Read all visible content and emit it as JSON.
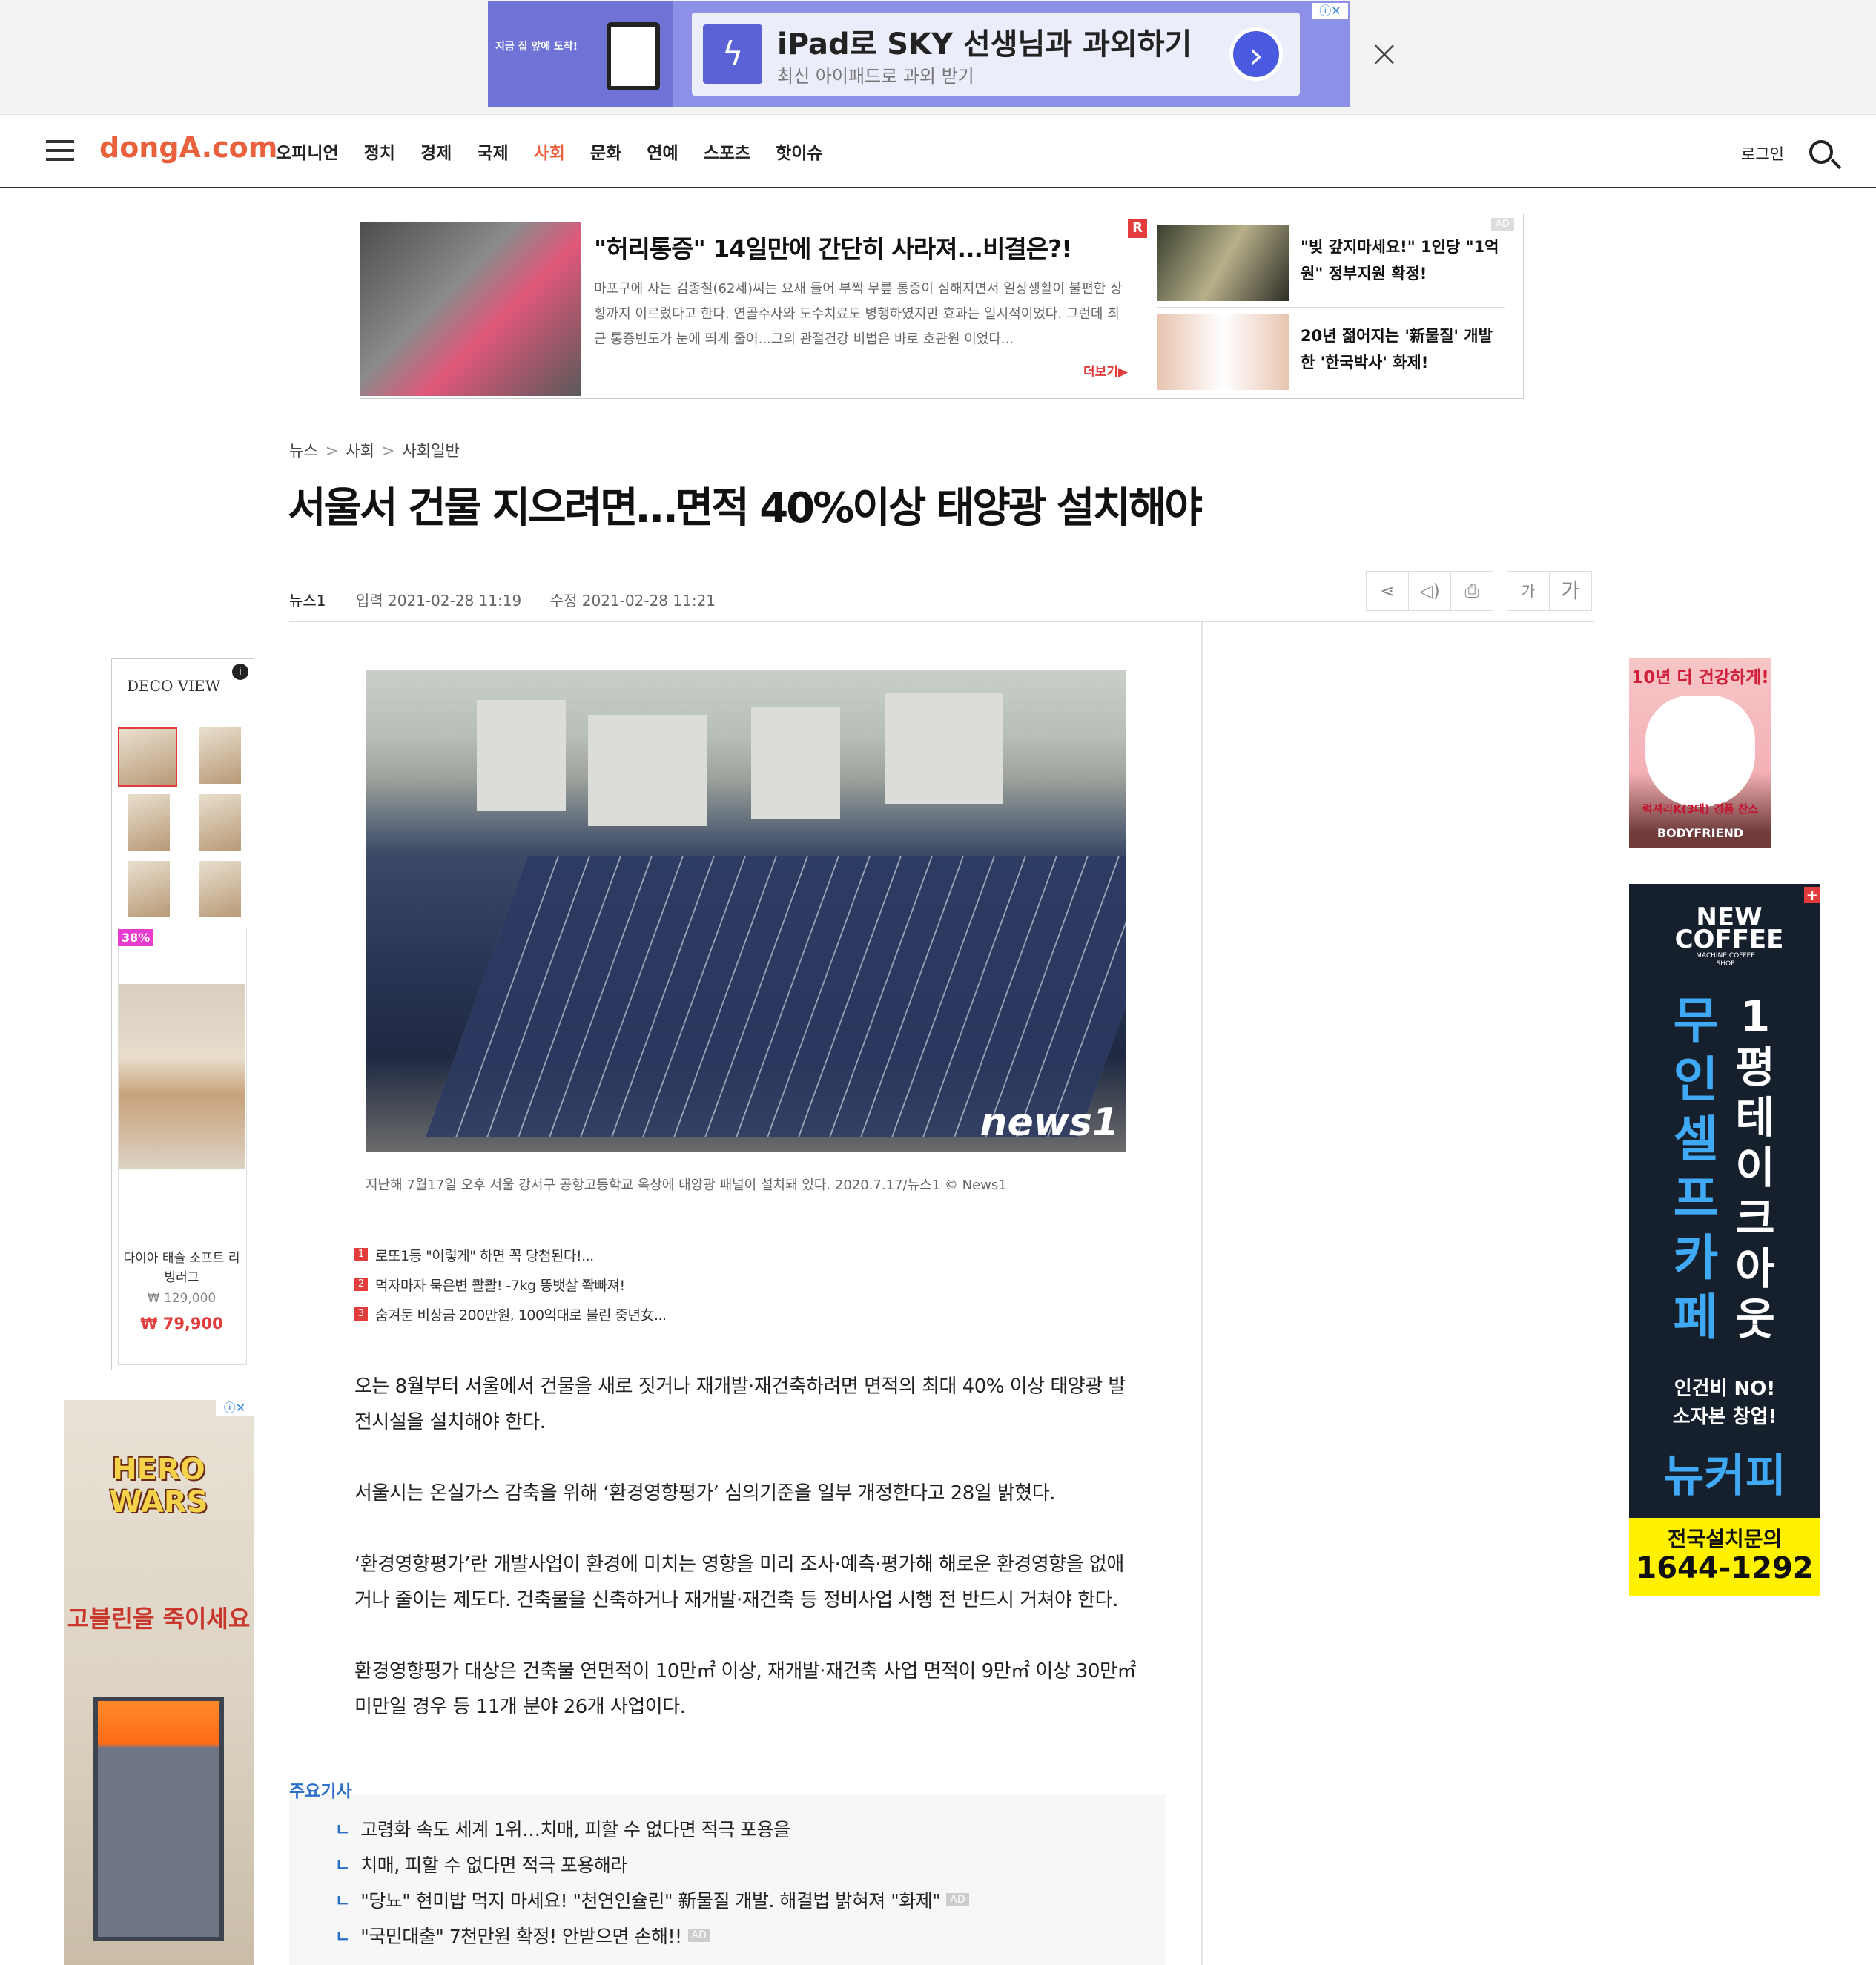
{
  "top_ad": {
    "thumb_text": "지금 집 앞에 도착!",
    "headline": "iPad로 SKY 선생님과 과외하기",
    "subtext": "최신 아이패드로 과외 받기",
    "adchoice": "ⓘ✕"
  },
  "header": {
    "logo": "dongA.com",
    "nav": [
      "오피니언",
      "정치",
      "경제",
      "국제",
      "사회",
      "문화",
      "연예",
      "스포츠",
      "핫이슈"
    ],
    "active_nav": "사회",
    "login": "로그인"
  },
  "ad_banner": {
    "title": "\"허리통증\" 14일만에 간단히 사라져...비결은?!",
    "description": "마포구에 사는 김종철(62세)씨는 요새 들어 부쩍 무릎 통증이 심해지면서 일상생활이 불편한 상황까지 이르렀다고 한다. 연골주사와 도수치료도 병행하였지만 효과는 일시적이었다. 그런데 최근 통증빈도가 눈에 띄게 줄어...그의 관절건강 비법은 바로 호관원 이었다...",
    "more": "더보기▶",
    "badge": "R",
    "ad_tag": "AD",
    "item1": "\"빚 갚지마세요!\" 1인당 \"1억원\" 정부지원 확정!",
    "item2": "20년 젊어지는 '新물질' 개발한 '한국박사' 화제!"
  },
  "article": {
    "breadcrumb": [
      "뉴스",
      "사회",
      "사회일반"
    ],
    "title": "서울서 건물 지으려면…면적 40%이상 태양광 설치해야",
    "source": "뉴스1",
    "input_time": "입력 2021-02-28 11:19",
    "modified_time": "수정 2021-02-28 11:21",
    "photo_mark": "news1",
    "caption": "지난해 7월17일 오후 서울 강서구 공항고등학교 옥상에 태양광 패널이 설치돼 있다. 2020.7.17/뉴스1 © News1",
    "ranked_links": [
      {
        "num": "1",
        "text": "로또1등 \"이렇게\" 하면 꼭 당첨된다!..."
      },
      {
        "num": "2",
        "text": "먹자마자 묵은변 콸콸! -7kg 똥뱃살 쫙빠져!"
      },
      {
        "num": "3",
        "text": "숨겨둔 비상금 200만원, 100억대로 불린 중년女..."
      }
    ],
    "paragraphs": [
      "오는 8월부터 서울에서 건물을 새로 짓거나 재개발·재건축하려면 면적의 최대 40% 이상 태양광 발전시설을 설치해야 한다.",
      "서울시는 온실가스 감축을 위해 ‘환경영향평가’ 심의기준을 일부 개정한다고 28일 밝혔다.",
      "‘환경영향평가’란 개발사업이 환경에 미치는 영향을 미리 조사·예측·평가해 해로운 환경영향을 없애거나 줄이는 제도다. 건축물을 신축하거나 재개발·재건축 등 정비사업 시행 전 반드시 거쳐야 한다.",
      "환경영향평가 대상은 건축물 연면적이 10만㎡ 이상, 재개발·재건축 사업 면적이 9만㎡ 이상 30만㎡ 미만일 경우 등 11개 분야 26개 사업이다."
    ]
  },
  "tools": {
    "font_small": "가",
    "font_large": "가"
  },
  "related": {
    "label": "주요기사",
    "items": [
      {
        "text": "고령화 속도 세계 1위…치매, 피할 수 없다면 적극 포용을",
        "ad": ""
      },
      {
        "text": "치매, 피할 수 없다면 적극 포용해라",
        "ad": ""
      },
      {
        "text": "\"당뇨\" 현미밥 먹지 마세요! \"천연인슐린\" 新물질 개발. 해결법 밝혀져 \"화제\"",
        "ad": "AD"
      },
      {
        "text": "\"국민대출\" 7천만원 확정! 안받으면 손해!!",
        "ad": "AD"
      }
    ]
  },
  "left_ad": {
    "brand": "DECO VIEW",
    "discount": "38%",
    "product_name": "다이아 태슬 소프트 리빙러그",
    "old_price": "₩ 129,000",
    "price": "₩ 79,900"
  },
  "left_ad2": {
    "logo": "HERO WARS",
    "cta": "고블린을 죽이세요",
    "adchoice": "ⓘ✕"
  },
  "right_ad1": {
    "title": "10년 더 건강하게!",
    "line": "럭셔리K(3대) 경품 찬스",
    "brand": "BODYFRIEND"
  },
  "right_ad2": {
    "brand": "NEW COFFEE",
    "brand_sub": "MACHINE COFFEE SHOP",
    "col1": "무인셀프카페",
    "col2": "1평테이크아웃",
    "line1": "인건비 NO!",
    "line2": "소자본 창업!",
    "brand_ko": "뉴커피",
    "footer1": "전국설치문의",
    "footer2": "1644-1292"
  }
}
